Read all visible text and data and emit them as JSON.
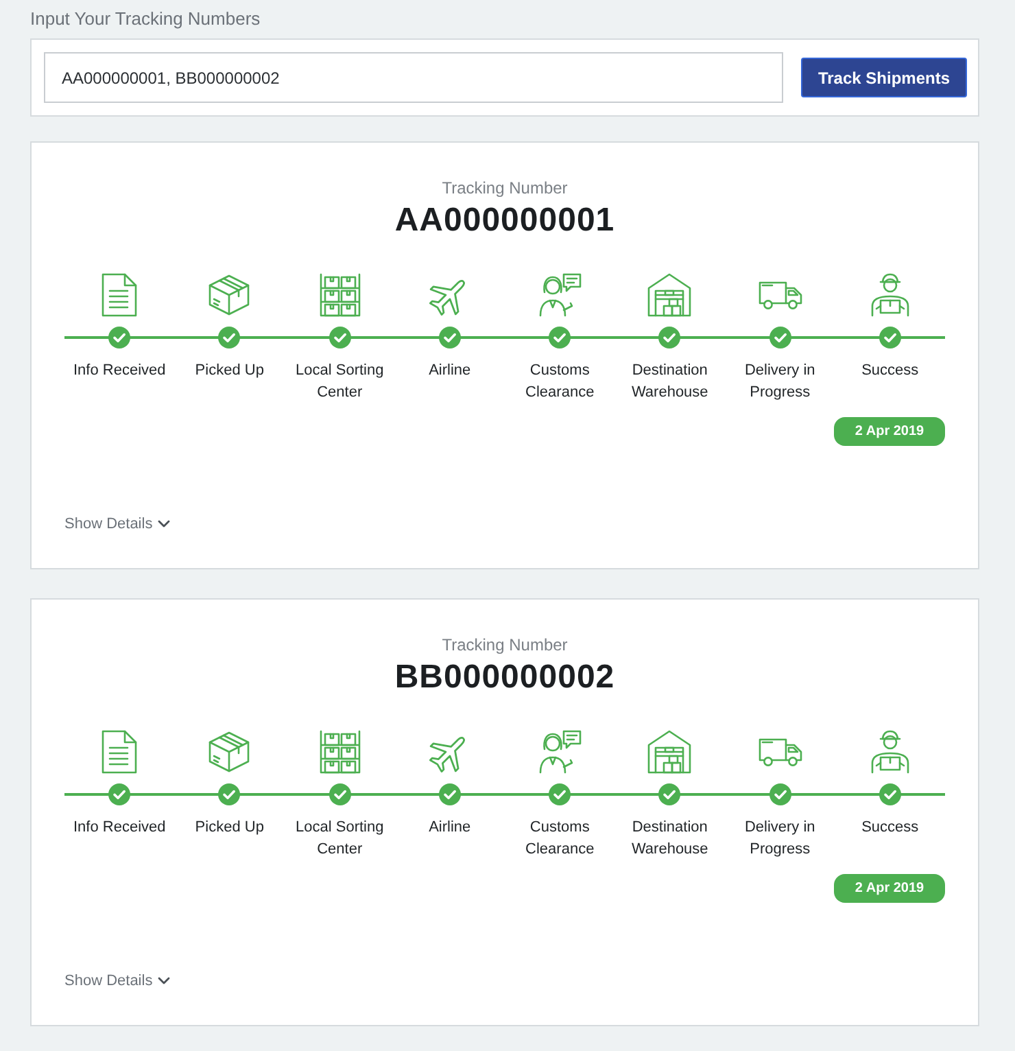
{
  "input_label": "Input Your Tracking Numbers",
  "search": {
    "value": "AA000000001, BB000000002",
    "button": "Track Shipments"
  },
  "shipments": [
    {
      "heading": "Tracking Number",
      "number": "AA000000001",
      "steps": [
        {
          "kind": "document",
          "label": "Info Received",
          "done": true
        },
        {
          "kind": "package",
          "label": "Picked Up",
          "done": true
        },
        {
          "kind": "shelves",
          "label": "Local Sorting Center",
          "done": true
        },
        {
          "kind": "plane",
          "label": "Airline",
          "done": true
        },
        {
          "kind": "agent",
          "label": "Customs Clearance",
          "done": true
        },
        {
          "kind": "warehouse",
          "label": "Destination Warehouse",
          "done": true
        },
        {
          "kind": "truck",
          "label": "Delivery in Progress",
          "done": true
        },
        {
          "kind": "courier",
          "label": "Success",
          "done": true
        }
      ],
      "date": "2 Apr 2019",
      "details_toggle": "Show Details",
      "expanded": false
    },
    {
      "heading": "Tracking Number",
      "number": "BB000000002",
      "steps": [
        {
          "kind": "document",
          "label": "Info Received",
          "done": true
        },
        {
          "kind": "package",
          "label": "Picked Up",
          "done": true
        },
        {
          "kind": "shelves",
          "label": "Local Sorting Center",
          "done": true
        },
        {
          "kind": "plane",
          "label": "Airline",
          "done": true
        },
        {
          "kind": "agent",
          "label": "Customs Clearance",
          "done": true
        },
        {
          "kind": "warehouse",
          "label": "Destination Warehouse",
          "done": true
        },
        {
          "kind": "truck",
          "label": "Delivery in Progress",
          "done": true
        },
        {
          "kind": "courier",
          "label": "Success",
          "done": true
        }
      ],
      "date": "2 Apr 2019",
      "details_toggle": "Show Details",
      "expanded": false
    }
  ]
}
